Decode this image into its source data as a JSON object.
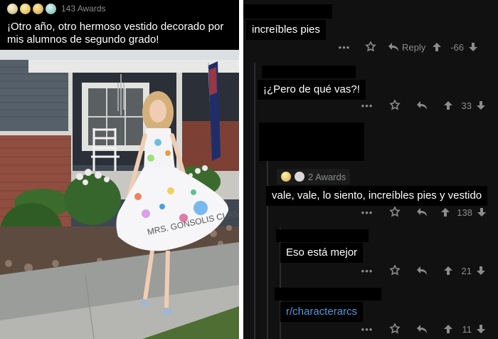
{
  "post": {
    "awards_count": "143 Awards",
    "award_icons": [
      {
        "name": "silver-award-icon",
        "color": "#c9c6a8"
      },
      {
        "name": "gold-award-icon",
        "color": "#e9c46a"
      },
      {
        "name": "helpful-award-icon",
        "color": "#d9b45a"
      },
      {
        "name": "wholesome-award-icon",
        "color": "#8fd0c8"
      }
    ],
    "caption": "¡Otro año, otro hermoso vestido decorado por mis alumnos de segundo grado!",
    "photo_text": "MRS. GONSOLIS CLASS"
  },
  "comments": [
    {
      "id": "c1",
      "text": "increíbles pies",
      "score": "-66",
      "reply_label": "Reply"
    },
    {
      "id": "c2",
      "text": "¡¿Pero de qué vas?!",
      "score": "33"
    },
    {
      "id": "c3",
      "awards_count": "2 Awards",
      "text": "vale, vale, lo siento, increíbles pies y vestido",
      "score": "138"
    },
    {
      "id": "c4",
      "text": "Eso está mejor",
      "score": "21"
    },
    {
      "id": "c5",
      "text": "r/characterarcs",
      "score": "11"
    }
  ],
  "colors": {
    "background": "#111111",
    "text": "#ffffff",
    "muted": "#8a8c8e",
    "link": "#4b9be0"
  }
}
